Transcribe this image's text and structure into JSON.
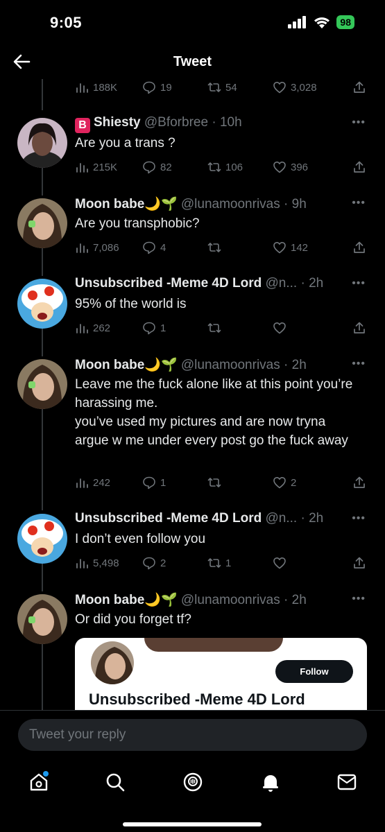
{
  "status": {
    "time": "9:05",
    "battery": "98"
  },
  "header": {
    "title": "Tweet"
  },
  "top_actions": {
    "views": "188K",
    "replies": "19",
    "retweets": "54",
    "likes": "3,028"
  },
  "tweets": [
    {
      "name": "Shiesty",
      "handle": "@Bforbree",
      "time": "10h",
      "body": "Are you a trans ?",
      "views": "215K",
      "replies": "82",
      "retweets": "106",
      "likes": "396"
    },
    {
      "name": "Moon babe",
      "emoji": "🌙🌱",
      "handle": "@lunamoonrivas",
      "time": "9h",
      "body": "Are you transphobic?",
      "views": "7,086",
      "replies": "4",
      "retweets": "",
      "likes": "142"
    },
    {
      "name": "Unsubscribed -Meme 4D Lord",
      "handle": "@n...",
      "time": "2h",
      "body": "95% of the world is",
      "views": "262",
      "replies": "1",
      "retweets": "",
      "likes": ""
    },
    {
      "name": "Moon babe",
      "emoji": "🌙🌱",
      "handle": "@lunamoonrivas",
      "time": "2h",
      "body": "Leave me the fuck alone like at this point you’re harassing me.\nyou’ve used my pictures and are now tryna argue w me under every post go the fuck away",
      "views": "242",
      "replies": "1",
      "retweets": "",
      "likes": "2"
    },
    {
      "name": "Unsubscribed -Meme 4D Lord",
      "handle": "@n...",
      "time": "2h",
      "body": "I don’t even follow you",
      "views": "5,498",
      "replies": "2",
      "retweets": "1",
      "likes": ""
    },
    {
      "name": "Moon babe",
      "emoji": "🌙🌱",
      "handle": "@lunamoonrivas",
      "time": "2h",
      "body": "Or did you forget tf?"
    }
  ],
  "embed": {
    "follow_label": "Follow",
    "name": "Unsubscribed -Meme 4D Lord"
  },
  "reply": {
    "placeholder": "Tweet your reply"
  },
  "nav": {
    "items": [
      "home-icon",
      "search-icon",
      "spaces-icon",
      "notifications-icon",
      "messages-icon"
    ]
  },
  "colors": {
    "accent": "#1d9bf0",
    "muted": "#71767b",
    "battery": "#34c759"
  }
}
